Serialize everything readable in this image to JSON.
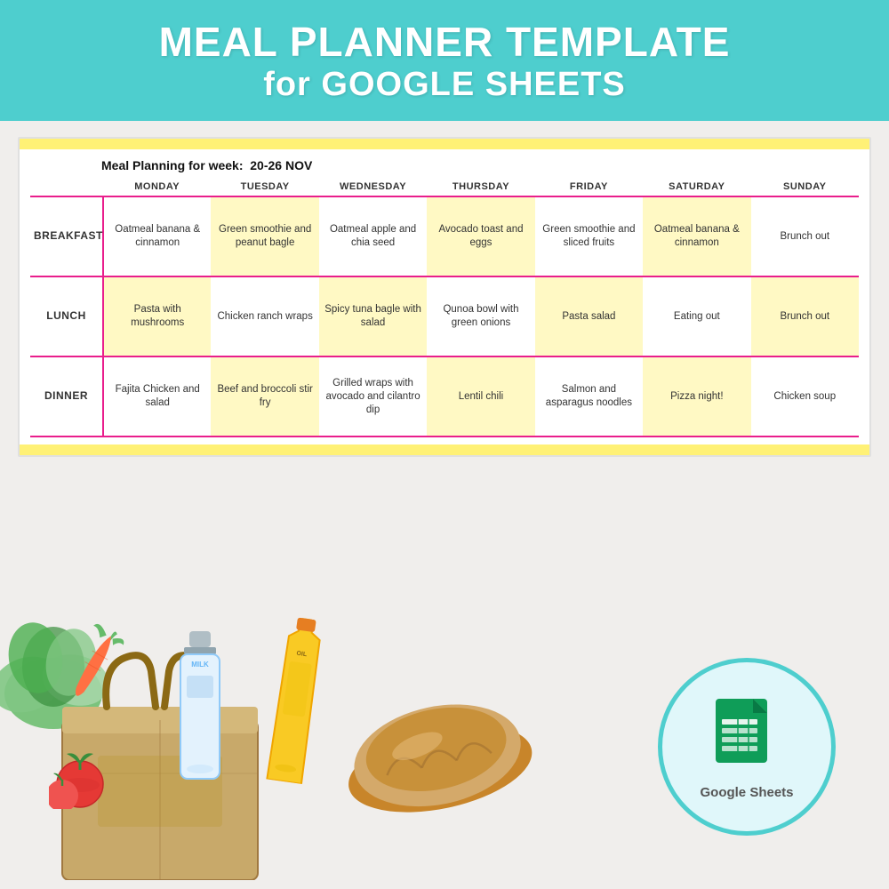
{
  "header": {
    "line1": "MEAL PLANNER TEMPLATE",
    "line2": "for GOOGLE SHEETS"
  },
  "spreadsheet": {
    "week_label": "Meal Planning for week:",
    "week_range": "20-26 NOV",
    "columns": [
      "MONDAY",
      "TUESDAY",
      "WEDNESDAY",
      "THURSDAY",
      "FRIDAY",
      "SATURDAY",
      "SUNDAY"
    ],
    "rows": [
      {
        "label": "BREAKFAST",
        "cells": [
          "Oatmeal banana & cinnamon",
          "Green smoothie and peanut bagle",
          "Oatmeal apple and chia seed",
          "Avocado toast and eggs",
          "Green smoothie and sliced fruits",
          "Oatmeal banana & cinnamon",
          "Brunch out"
        ]
      },
      {
        "label": "LUNCH",
        "cells": [
          "Pasta with mushrooms",
          "Chicken ranch wraps",
          "Spicy tuna bagle with salad",
          "Qunoa bowl with green onions",
          "Pasta salad",
          "Eating out",
          "Brunch out"
        ]
      },
      {
        "label": "DINNER",
        "cells": [
          "Fajita Chicken and salad",
          "Beef and broccoli stir fry",
          "Grilled wraps with avocado and cilantro dip",
          "Lentil chili",
          "Salmon and asparagus noodles",
          "Pizza night!",
          "Chicken soup"
        ]
      }
    ]
  },
  "google_sheets": {
    "label": "Google Sheets"
  },
  "colors": {
    "teal": "#4ecece",
    "yellow_bar": "#fff176",
    "cell_yellow": "#fff9c4",
    "pink_border": "#e91e8c"
  }
}
